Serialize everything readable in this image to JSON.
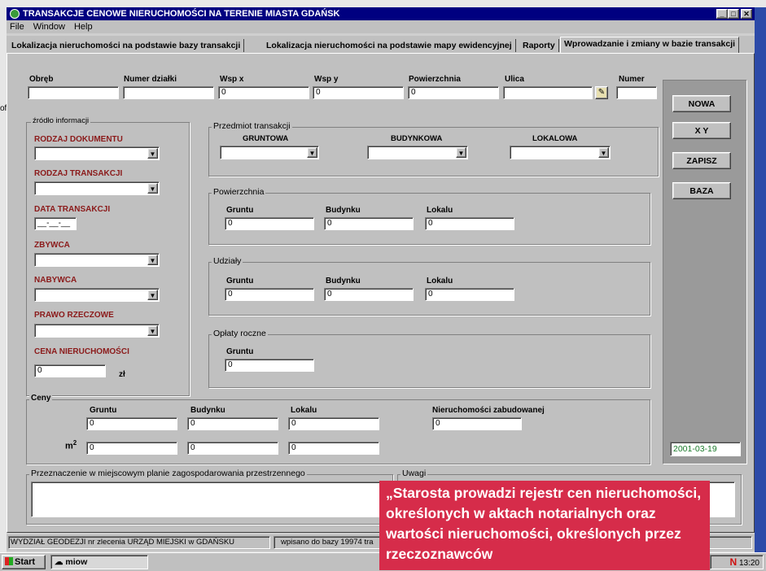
{
  "window": {
    "title": "TRANSAKCJE CENOWE NIERUCHOMOŚCI NA TERENIE MIASTA GDAŃSK"
  },
  "menu": [
    "File",
    "Window",
    "Help"
  ],
  "tabs": [
    "Lokalizacja nieruchomości na podstawie bazy transakcji",
    "Lokalizacja nieruchomości na podstawie mapy ewidencyjnej",
    "Raporty",
    "Wprowadzanie i zmiany w bazie transakcji"
  ],
  "top_fields": {
    "obreb": {
      "label": "Obręb",
      "value": ""
    },
    "numer_dzialki": {
      "label": "Numer działki",
      "value": ""
    },
    "wsp_x": {
      "label": "Wsp x",
      "value": "0"
    },
    "wsp_y": {
      "label": "Wsp y",
      "value": "0"
    },
    "powierzchnia": {
      "label": "Powierzchnia",
      "value": "0"
    },
    "ulica": {
      "label": "Ulica",
      "value": ""
    },
    "numer": {
      "label": "Numer",
      "value": ""
    }
  },
  "buttons": {
    "nowa": "NOWA",
    "xy": "X Y",
    "zapisz": "ZAPISZ",
    "baza": "BAZA"
  },
  "date_display": "2001-03-19",
  "zrodlo": {
    "title": "źródło informacji",
    "rodzaj_dokumentu": "RODZAJ DOKUMENTU",
    "rodzaj_transakcji": "RODZAJ TRANSAKCJI",
    "data_transakcji": "DATA TRANSAKCJI",
    "data_value": "__-__-__",
    "zbywca": "ZBYWCA",
    "nabywca": "NABYWCA",
    "prawo_rzeczowe": "PRAWO RZECZOWE",
    "cena": "CENA NIERUCHOMOŚCI",
    "cena_value": "0",
    "currency": "zł"
  },
  "przedmiot": {
    "title": "Przedmiot transakcji",
    "gruntowa": "GRUNTOWA",
    "budynkowa": "BUDYNKOWA",
    "lokalowa": "LOKALOWA"
  },
  "powierzchnia": {
    "title": "Powierzchnia",
    "gruntu": "Gruntu",
    "budynku": "Budynku",
    "lokalu": "Lokalu",
    "v1": "0",
    "v2": "0",
    "v3": "0"
  },
  "udzialy": {
    "title": "Udziały",
    "gruntu": "Gruntu",
    "budynku": "Budynku",
    "lokalu": "Lokalu",
    "v1": "0",
    "v2": "0",
    "v3": "0"
  },
  "oplaty": {
    "title": "Opłaty roczne",
    "gruntu": "Gruntu",
    "v1": "0"
  },
  "ceny": {
    "title": "Ceny",
    "gruntu": "Gruntu",
    "budynku": "Budynku",
    "lokalu": "Lokalu",
    "zabudowanej": "Nieruchomości zabudowanej",
    "r1": [
      "0",
      "0",
      "0",
      "0"
    ],
    "unit_base": "m",
    "unit_exp": "2",
    "r2": [
      "0",
      "0",
      "0"
    ]
  },
  "przeznaczenie": {
    "title": "Przeznaczenie w miejscowym planie zagospodarowania przestrzennego"
  },
  "uwagi": {
    "title": "Uwagi"
  },
  "status": {
    "left": "WYDZIAŁ GEODEZJI nr zlecenia URZĄD MIEJSKI w GDAŃSKU",
    "right": "wpisano do bazy 19974 tra"
  },
  "taskbar": {
    "start": "Start",
    "app": "miow",
    "clock": "13:20"
  },
  "left_edge": {
    "fragment": "oft"
  },
  "quote": "„Starosta prowadzi rejestr cen nieruchomości, określonych w aktach notarialnych oraz wartości nieruchomości, określonych przez rzeczoznawców"
}
